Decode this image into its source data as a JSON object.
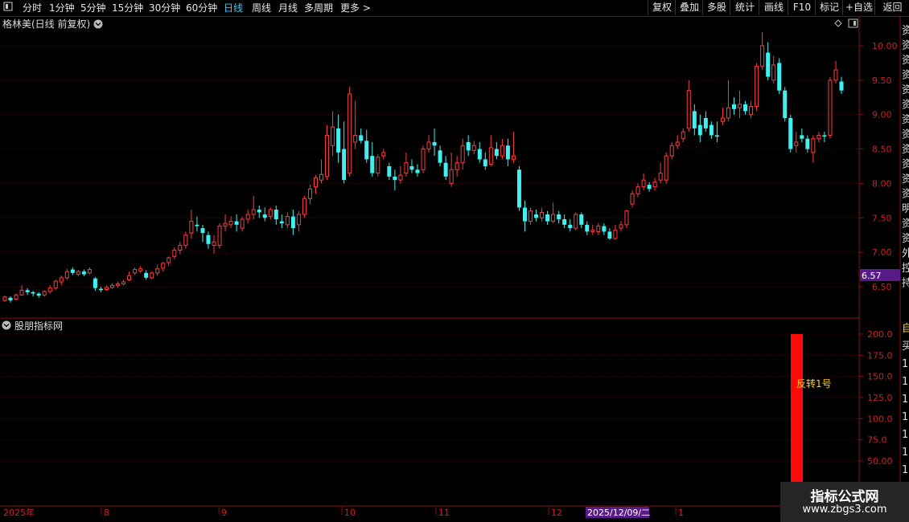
{
  "toolbar": {
    "left_items": [
      "分时",
      "1分钟",
      "5分钟",
      "15分钟",
      "30分钟",
      "60分钟",
      "日线",
      "周线",
      "月线",
      "多周期",
      "更多 >"
    ],
    "active_item": "日线",
    "right_items": [
      "复权",
      "叠加",
      "多股",
      "统计",
      "画线",
      "F10",
      "标记",
      "+自选",
      "返回"
    ]
  },
  "main_panel": {
    "title": "格林美(日线 前复权)",
    "price_axis": [
      "10.00",
      "9.50",
      "9.00",
      "8.50",
      "8.00",
      "7.50",
      "7.00",
      "6.50"
    ],
    "current_price_tag": "6.57",
    "right_cut_chars": [
      "资",
      "资",
      "资",
      "资",
      "资",
      "资",
      "资",
      "资",
      "资",
      "资",
      "资",
      "资",
      "明",
      "资",
      "资",
      "外",
      "控",
      "持"
    ]
  },
  "indicator_panel": {
    "title": "股朋指标网",
    "axis": [
      "200.0",
      "175.0",
      "150.0",
      "125.0",
      "100.0",
      "75.0",
      "50.00"
    ],
    "signal_label": "反转1号",
    "signal_value": 200,
    "right_cut_chars": [
      "自",
      "买",
      "1",
      "1",
      "1",
      "1",
      "1",
      "1",
      "1",
      "1"
    ]
  },
  "time_axis": {
    "labels": [
      "2025年",
      "8",
      "9",
      "10",
      "11",
      "12",
      "1"
    ],
    "crosshair_date": "2025/12/09/二"
  },
  "chart_data": {
    "type": "candlestick",
    "ylim": [
      6.2,
      10.3
    ],
    "indicator_ylim": [
      25,
      212
    ],
    "candles": [
      [
        6.3,
        6.35,
        6.28,
        6.37
      ],
      [
        6.34,
        6.3,
        6.27,
        6.36
      ],
      [
        6.32,
        6.38,
        6.3,
        6.4
      ],
      [
        6.38,
        6.45,
        6.37,
        6.52
      ],
      [
        6.45,
        6.42,
        6.38,
        6.48
      ],
      [
        6.42,
        6.4,
        6.36,
        6.44
      ],
      [
        6.4,
        6.37,
        6.34,
        6.42
      ],
      [
        6.38,
        6.43,
        6.36,
        6.45
      ],
      [
        6.43,
        6.48,
        6.4,
        6.52
      ],
      [
        6.48,
        6.58,
        6.45,
        6.6
      ],
      [
        6.57,
        6.63,
        6.52,
        6.66
      ],
      [
        6.63,
        6.72,
        6.6,
        6.76
      ],
      [
        6.75,
        6.7,
        6.67,
        6.78
      ],
      [
        6.68,
        6.72,
        6.65,
        6.74
      ],
      [
        6.72,
        6.68,
        6.65,
        6.75
      ],
      [
        6.7,
        6.75,
        6.68,
        6.78
      ],
      [
        6.62,
        6.48,
        6.44,
        6.64
      ],
      [
        6.47,
        6.45,
        6.42,
        6.5
      ],
      [
        6.46,
        6.49,
        6.44,
        6.52
      ],
      [
        6.49,
        6.52,
        6.47,
        6.55
      ],
      [
        6.52,
        6.54,
        6.49,
        6.57
      ],
      [
        6.54,
        6.57,
        6.52,
        6.6
      ],
      [
        6.6,
        6.66,
        6.58,
        6.72
      ],
      [
        6.7,
        6.75,
        6.67,
        6.78
      ],
      [
        6.73,
        6.76,
        6.7,
        6.8
      ],
      [
        6.7,
        6.63,
        6.6,
        6.74
      ],
      [
        6.63,
        6.7,
        6.61,
        6.72
      ],
      [
        6.7,
        6.76,
        6.66,
        6.82
      ],
      [
        6.77,
        6.84,
        6.72,
        6.86
      ],
      [
        6.85,
        6.92,
        6.8,
        6.94
      ],
      [
        6.94,
        7.03,
        6.9,
        7.07
      ],
      [
        7.03,
        7.1,
        6.97,
        7.15
      ],
      [
        7.1,
        7.25,
        7.05,
        7.3
      ],
      [
        7.28,
        7.45,
        7.2,
        7.62
      ],
      [
        7.4,
        7.38,
        7.3,
        7.52
      ],
      [
        7.35,
        7.28,
        7.15,
        7.4
      ],
      [
        7.25,
        7.12,
        7.05,
        7.3
      ],
      [
        7.1,
        7.15,
        6.98,
        7.25
      ],
      [
        7.1,
        7.38,
        7.05,
        7.42
      ],
      [
        7.38,
        7.42,
        7.3,
        7.55
      ],
      [
        7.4,
        7.45,
        7.35,
        7.52
      ],
      [
        7.45,
        7.4,
        7.3,
        7.55
      ],
      [
        7.35,
        7.48,
        7.3,
        7.52
      ],
      [
        7.48,
        7.55,
        7.42,
        7.62
      ],
      [
        7.55,
        7.62,
        7.48,
        7.82
      ],
      [
        7.62,
        7.58,
        7.5,
        7.68
      ],
      [
        7.55,
        7.5,
        7.45,
        7.65
      ],
      [
        7.52,
        7.62,
        7.48,
        7.65
      ],
      [
        7.62,
        7.48,
        7.4,
        7.68
      ],
      [
        7.45,
        7.42,
        7.35,
        7.55
      ],
      [
        7.4,
        7.52,
        7.35,
        7.58
      ],
      [
        7.52,
        7.35,
        7.25,
        7.62
      ],
      [
        7.4,
        7.55,
        7.3,
        7.6
      ],
      [
        7.55,
        7.78,
        7.5,
        7.82
      ],
      [
        7.78,
        7.92,
        7.7,
        7.98
      ],
      [
        7.95,
        8.08,
        7.85,
        8.12
      ],
      [
        8.05,
        8.13,
        8.0,
        8.35
      ],
      [
        8.1,
        8.7,
        8.05,
        8.85
      ],
      [
        8.55,
        8.82,
        8.4,
        9.05
      ],
      [
        8.8,
        8.45,
        8.3,
        9.0
      ],
      [
        8.5,
        8.05,
        8.0,
        8.9
      ],
      [
        8.15,
        9.3,
        8.1,
        9.4
      ],
      [
        8.6,
        8.7,
        8.5,
        9.2
      ],
      [
        8.7,
        8.62,
        8.58,
        8.8
      ],
      [
        8.62,
        8.35,
        8.3,
        8.78
      ],
      [
        8.4,
        8.15,
        8.1,
        8.6
      ],
      [
        8.15,
        8.38,
        8.1,
        8.42
      ],
      [
        8.4,
        8.45,
        8.35,
        8.5
      ],
      [
        8.25,
        8.1,
        8.05,
        8.3
      ],
      [
        8.1,
        8.05,
        7.9,
        8.2
      ],
      [
        8.05,
        8.12,
        8.0,
        8.25
      ],
      [
        8.15,
        8.3,
        8.1,
        8.45
      ],
      [
        8.25,
        8.2,
        8.15,
        8.35
      ],
      [
        8.2,
        8.15,
        8.1,
        8.28
      ],
      [
        8.2,
        8.5,
        8.15,
        8.55
      ],
      [
        8.5,
        8.6,
        8.45,
        8.7
      ],
      [
        8.6,
        8.55,
        8.4,
        8.8
      ],
      [
        8.48,
        8.3,
        8.25,
        8.55
      ],
      [
        8.3,
        8.1,
        8.05,
        8.4
      ],
      [
        8.0,
        8.2,
        7.95,
        8.45
      ],
      [
        8.2,
        8.3,
        8.1,
        8.4
      ],
      [
        8.3,
        8.55,
        8.2,
        8.65
      ],
      [
        8.6,
        8.48,
        8.4,
        8.7
      ],
      [
        8.48,
        8.55,
        8.42,
        8.62
      ],
      [
        8.5,
        8.35,
        8.3,
        8.6
      ],
      [
        8.35,
        8.25,
        8.2,
        8.45
      ],
      [
        8.28,
        8.52,
        8.25,
        8.7
      ],
      [
        8.5,
        8.4,
        8.35,
        8.6
      ],
      [
        8.4,
        8.55,
        8.35,
        8.65
      ],
      [
        8.55,
        8.35,
        8.25,
        8.65
      ],
      [
        8.35,
        8.4,
        8.3,
        8.75
      ],
      [
        8.2,
        7.65,
        7.6,
        8.25
      ],
      [
        7.65,
        7.45,
        7.3,
        7.75
      ],
      [
        7.45,
        7.6,
        7.4,
        7.65
      ],
      [
        7.55,
        7.5,
        7.45,
        7.62
      ],
      [
        7.5,
        7.58,
        7.45,
        7.65
      ],
      [
        7.55,
        7.45,
        7.4,
        7.6
      ],
      [
        7.45,
        7.55,
        7.42,
        7.72
      ],
      [
        7.55,
        7.48,
        7.42,
        7.6
      ],
      [
        7.48,
        7.4,
        7.35,
        7.55
      ],
      [
        7.4,
        7.35,
        7.3,
        7.48
      ],
      [
        7.35,
        7.55,
        7.32,
        7.58
      ],
      [
        7.55,
        7.4,
        7.35,
        7.58
      ],
      [
        7.4,
        7.3,
        7.25,
        7.45
      ],
      [
        7.3,
        7.32,
        7.25,
        7.4
      ],
      [
        7.3,
        7.38,
        7.25,
        7.42
      ],
      [
        7.38,
        7.3,
        7.25,
        7.42
      ],
      [
        7.3,
        7.2,
        7.18,
        7.35
      ],
      [
        7.2,
        7.32,
        7.18,
        7.4
      ],
      [
        7.35,
        7.4,
        7.3,
        7.45
      ],
      [
        7.4,
        7.6,
        7.35,
        7.62
      ],
      [
        7.7,
        7.85,
        7.65,
        7.9
      ],
      [
        7.85,
        7.95,
        7.8,
        8.0
      ],
      [
        7.95,
        8.05,
        7.9,
        8.15
      ],
      [
        7.98,
        7.92,
        7.88,
        8.02
      ],
      [
        7.95,
        8.02,
        7.9,
        8.08
      ],
      [
        8.05,
        8.15,
        8.0,
        8.3
      ],
      [
        8.05,
        8.4,
        8.0,
        8.45
      ],
      [
        8.4,
        8.55,
        8.35,
        8.6
      ],
      [
        8.55,
        8.6,
        8.5,
        8.7
      ],
      [
        8.65,
        8.75,
        8.6,
        8.8
      ],
      [
        8.8,
        9.35,
        8.75,
        9.5
      ],
      [
        9.05,
        8.8,
        8.7,
        9.15
      ],
      [
        8.85,
        8.7,
        8.6,
        9.0
      ],
      [
        8.95,
        8.8,
        8.75,
        9.05
      ],
      [
        8.85,
        8.7,
        8.65,
        8.9
      ],
      [
        8.7,
        8.68,
        8.6,
        8.9
      ],
      [
        8.9,
        8.95,
        8.85,
        9.1
      ],
      [
        8.95,
        9.1,
        8.9,
        9.5
      ],
      [
        9.15,
        9.08,
        9.0,
        9.25
      ],
      [
        9.1,
        9.15,
        8.95,
        9.35
      ],
      [
        9.15,
        9.05,
        9.0,
        9.2
      ],
      [
        9.0,
        9.12,
        8.95,
        9.2
      ],
      [
        9.12,
        9.7,
        9.05,
        9.75
      ],
      [
        9.7,
        10.0,
        9.65,
        10.2
      ],
      [
        9.9,
        9.55,
        9.5,
        10.05
      ],
      [
        9.5,
        9.72,
        9.45,
        9.85
      ],
      [
        9.75,
        9.35,
        9.3,
        9.82
      ],
      [
        9.35,
        8.95,
        8.9,
        9.4
      ],
      [
        8.95,
        8.5,
        8.45,
        9.0
      ],
      [
        8.55,
        8.6,
        8.45,
        8.75
      ],
      [
        8.7,
        8.65,
        8.6,
        8.8
      ],
      [
        8.65,
        8.5,
        8.45,
        8.7
      ],
      [
        8.45,
        8.65,
        8.3,
        8.7
      ],
      [
        8.65,
        8.7,
        8.6,
        8.75
      ],
      [
        8.7,
        8.68,
        8.6,
        8.75
      ],
      [
        8.7,
        9.5,
        8.65,
        9.55
      ],
      [
        9.5,
        9.65,
        9.45,
        9.78
      ],
      [
        9.48,
        9.35,
        9.3,
        9.55
      ]
    ]
  }
}
